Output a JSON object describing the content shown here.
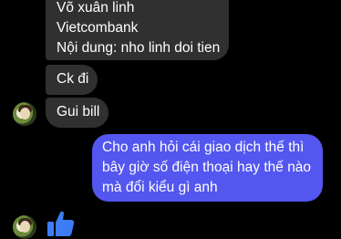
{
  "messages": {
    "incoming_top": {
      "lines": [
        "Võ xuân linh",
        "Vietcombank",
        "Nội dung: nho linh doi tien"
      ]
    },
    "incoming_ck": "Ck đi",
    "incoming_bill": "Gui bill",
    "outgoing": {
      "lines": [
        "Cho anh hỏi cái giao dịch thế thì",
        "bây giờ số điện thoại hay thế nào",
        "mà đổi kiểu gì anh"
      ]
    },
    "reaction_icon": "thumbs-up-icon"
  },
  "colors": {
    "background": "#000000",
    "incoming_bubble": "#303030",
    "outgoing_bubble": "#5356ef",
    "like": "#3d7cf5"
  }
}
